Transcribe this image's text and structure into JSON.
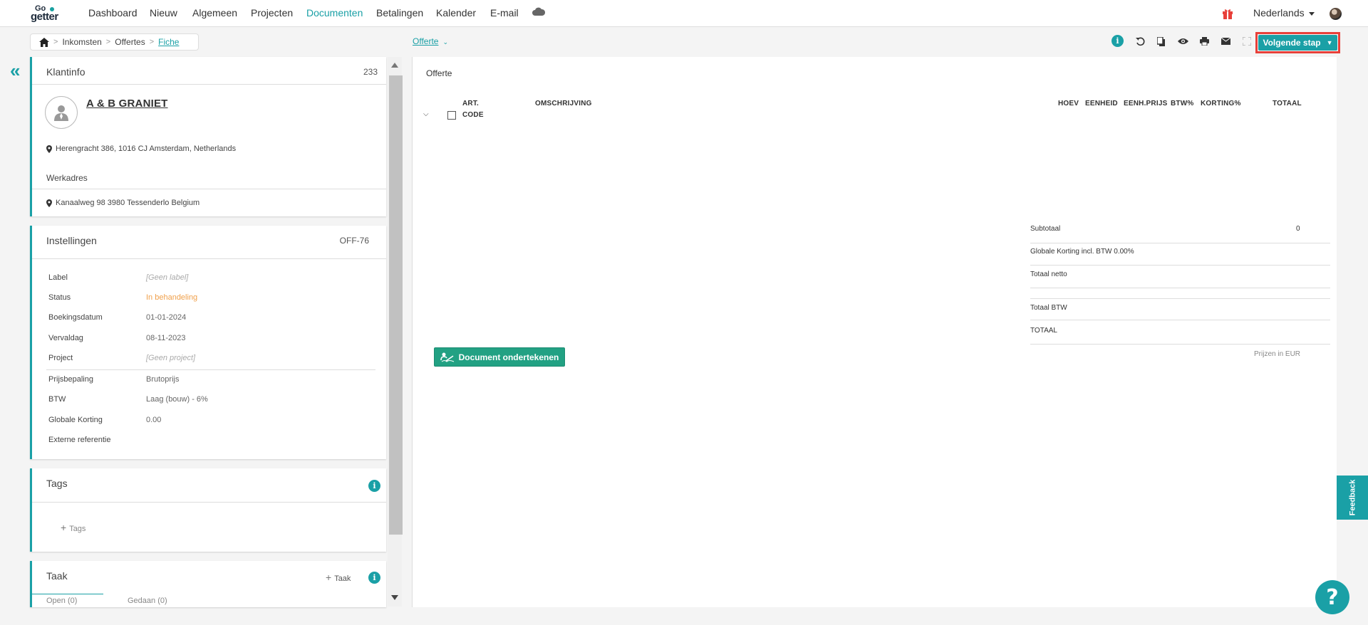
{
  "nav": {
    "logo_top": "Go",
    "logo_bottom": "getter",
    "items": [
      "Dashboard",
      "Nieuw",
      "Algemeen",
      "Projecten",
      "Documenten",
      "Betalingen",
      "Kalender",
      "E-mail"
    ],
    "active": "Documenten",
    "language": "Nederlands"
  },
  "breadcrumb": {
    "items": [
      "Inkomsten",
      "Offertes"
    ],
    "current": "Fiche"
  },
  "doc_type": "Offerte",
  "toolbar": {
    "info": "i",
    "next_step_label": "Volgende stap"
  },
  "client": {
    "title": "Klantinfo",
    "count": "233",
    "name": "A & B GRANIET",
    "address": "Herengracht 386, 1016 CJ Amsterdam, Netherlands",
    "work_address_label": "Werkadres",
    "work_address": "Kanaalweg 98 3980 Tessenderlo Belgium"
  },
  "settings": {
    "title": "Instellingen",
    "code": "OFF-76",
    "rows": [
      {
        "label": "Label",
        "value": "[Geen label]"
      },
      {
        "label": "Status",
        "value": "In behandeling"
      },
      {
        "label": "Boekingsdatum",
        "value": "01-01-2024"
      },
      {
        "label": "Vervaldag",
        "value": "08-11-2023"
      },
      {
        "label": "Project",
        "value": "[Geen project]"
      },
      {
        "label": "Prijsbepaling",
        "value": "Brutoprijs"
      },
      {
        "label": "BTW",
        "value": "Laag (bouw) - 6%"
      },
      {
        "label": "Globale Korting",
        "value": "0.00"
      },
      {
        "label": "Externe referentie",
        "value": ""
      }
    ]
  },
  "tags": {
    "title": "Tags",
    "add_label": "Tags"
  },
  "task": {
    "title": "Taak",
    "add_label": "Taak",
    "tabs": [
      "Open (0)",
      "Gedaan (0)"
    ]
  },
  "document": {
    "title": "Offerte",
    "columns": {
      "art_code_1": "ART.",
      "art_code_2": "CODE",
      "description": "OMSCHRIJVING",
      "qty": "HOEV",
      "unit": "EENHEID",
      "unit_price": "EENH.PRIJS",
      "vat": "BTW%",
      "discount": "KORTING%",
      "total": "TOTAAL"
    },
    "totals": {
      "subtotal_label": "Subtotaal",
      "subtotal_value": "0",
      "discount_label": "Globale Korting incl. BTW 0.00%",
      "net_label": "Totaal netto",
      "vat_label": "Totaal BTW",
      "total_label": "TOTAAL",
      "currency_note": "Prijzen in EUR"
    },
    "sign_button": "Document ondertekenen"
  },
  "feedback": "Feedback",
  "help": "?",
  "colors": {
    "accent": "#1aa0a6",
    "sign_button": "#22a183",
    "status": "#f0a04b",
    "annotation": "#e8403a"
  }
}
